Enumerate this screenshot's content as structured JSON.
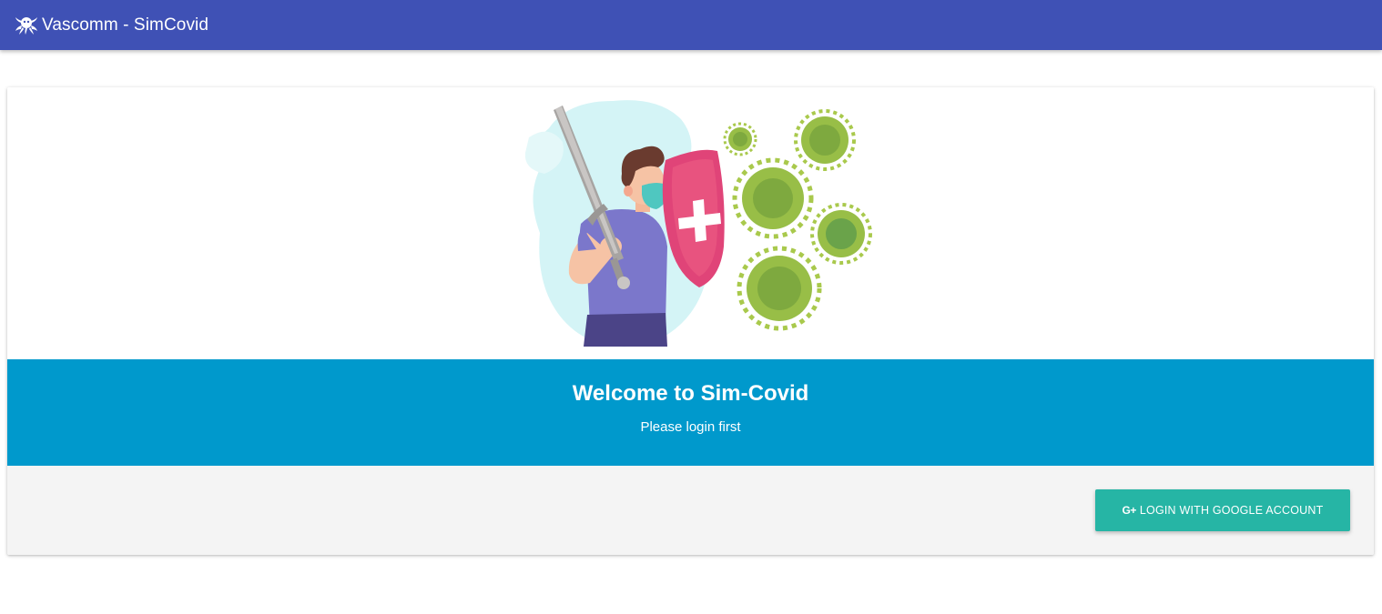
{
  "navbar": {
    "brand_icon": "octopus-icon",
    "title": "Vascomm - SimCovid",
    "background": "#3f51b5"
  },
  "card": {
    "illustration": {
      "icon": "covid-defender-illustration",
      "description_colors": {
        "blob": "#d3f4f7",
        "shirt": "#7a75c9",
        "shield": "#e04478",
        "virus": "#a9c94c"
      }
    },
    "banner": {
      "title": "Welcome to Sim-Covid",
      "subtitle": "Please login first",
      "background": "#0099cc"
    },
    "action": {
      "login_icon": "G+",
      "login_label": "LOGIN WITH GOOGLE ACCOUNT",
      "button_color": "#26b5a5"
    }
  }
}
